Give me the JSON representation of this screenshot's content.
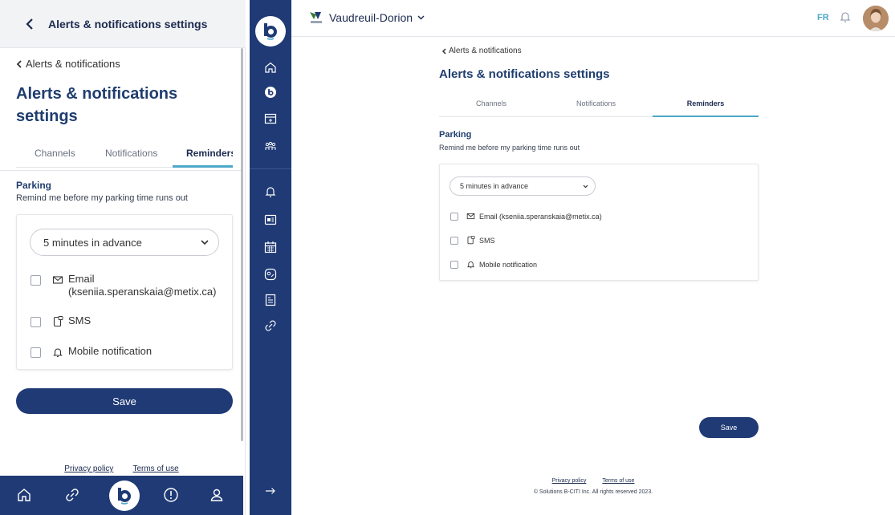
{
  "colors": {
    "primary": "#1f3a75",
    "accent": "#4da8c9",
    "heading": "#1f3d6e"
  },
  "mobile": {
    "topbar_title": "Alerts & notifications settings",
    "back_link": "Alerts & notifications",
    "heading": "Alerts & notifications settings",
    "tabs": [
      "Channels",
      "Notifications",
      "Reminders"
    ],
    "active_tab": "Reminders",
    "section": {
      "title": "Parking",
      "description": "Remind me before my parking time runs out"
    },
    "select_value": "5 minutes in advance",
    "options": {
      "email_label": "Email",
      "email_address": "(kseniia.speranskaia@metix.ca)",
      "sms_label": "SMS",
      "mobile_label": "Mobile notification"
    },
    "save_label": "Save",
    "footer": {
      "privacy": "Privacy policy",
      "terms": "Terms of use"
    },
    "bottom_nav": [
      "home-icon",
      "link-icon",
      "b-citi-logo-icon",
      "alert-icon",
      "user-icon"
    ]
  },
  "desktop": {
    "city_name": "Vaudreuil-Dorion",
    "language": "FR",
    "back_link": "Alerts & notifications",
    "heading": "Alerts & notifications settings",
    "tabs": [
      "Channels",
      "Notifications",
      "Reminders"
    ],
    "active_tab": "Reminders",
    "section": {
      "title": "Parking",
      "description": "Remind me before my parking time runs out"
    },
    "select_value": "5 minutes in advance",
    "options": {
      "email_label": "Email (kseniia.speranskaia@metix.ca)",
      "sms_label": "SMS",
      "mobile_label": "Mobile notification"
    },
    "save_label": "Save",
    "footer": {
      "privacy": "Privacy policy",
      "terms": "Terms of use",
      "copyright": "© Solutions B-CITI Inc. All rights reserved 2023."
    },
    "sidebar_icons": [
      "home-icon",
      "b-citi-icon",
      "payment-card-icon",
      "community-icon",
      "bell-icon",
      "news-icon",
      "calendar-icon",
      "chat-icon",
      "document-icon",
      "link-icon",
      "expand-arrow-icon"
    ]
  }
}
